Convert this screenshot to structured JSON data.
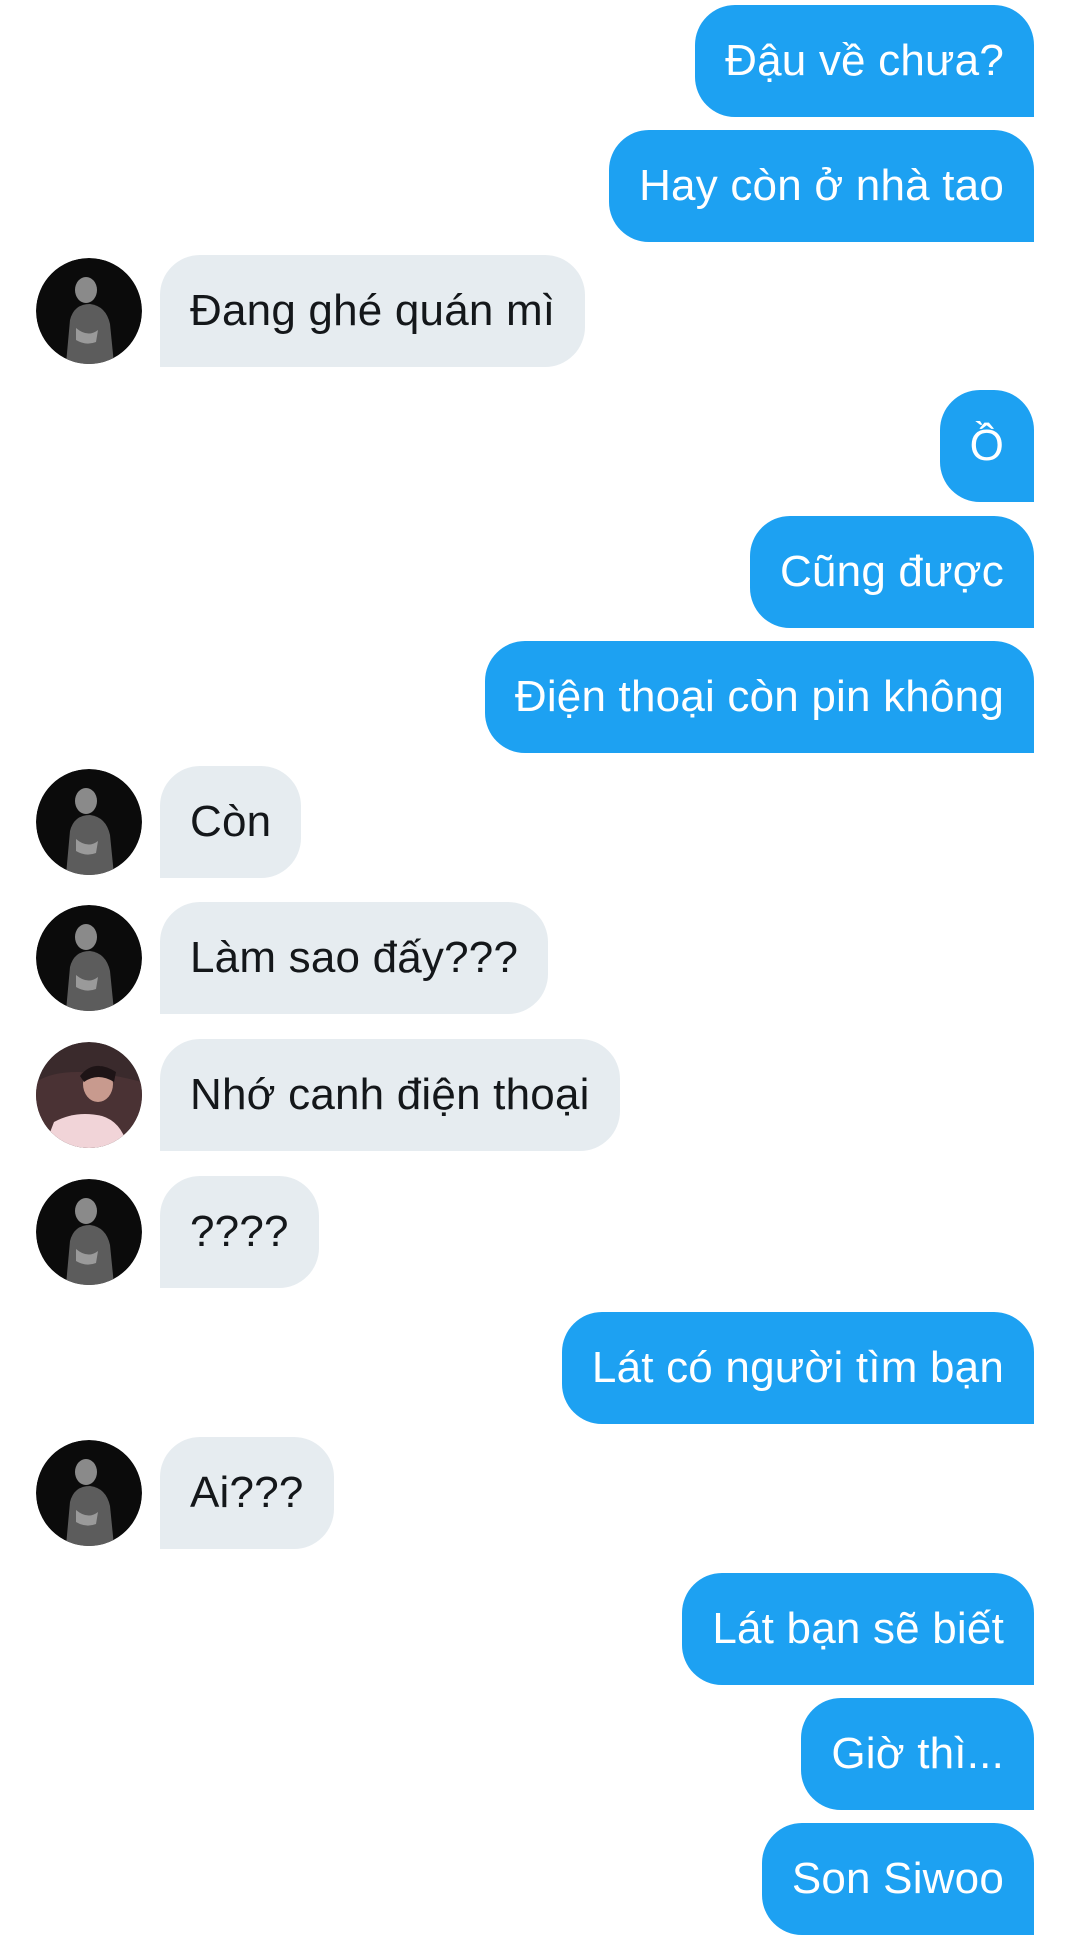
{
  "conversation": {
    "messages": [
      {
        "direction": "out",
        "text": "Đậu về chưa?"
      },
      {
        "direction": "out",
        "text": "Hay còn ở nhà tao"
      },
      {
        "direction": "in",
        "text": "Đang ghé quán mì",
        "avatar": "dark-avatar"
      },
      {
        "direction": "out",
        "text": "Ồ"
      },
      {
        "direction": "out",
        "text": "Cũng được"
      },
      {
        "direction": "out",
        "text": "Điện thoại còn pin không"
      },
      {
        "direction": "in",
        "text": "Còn",
        "avatar": "dark-avatar"
      },
      {
        "direction": "in",
        "text": "Làm sao đấy???",
        "avatar": "dark-avatar"
      },
      {
        "direction": "in",
        "text": "Nhớ canh điện thoại",
        "avatar": "pink-avatar"
      },
      {
        "direction": "in",
        "text": "????",
        "avatar": "dark-avatar"
      },
      {
        "direction": "out",
        "text": "Lát có người tìm bạn"
      },
      {
        "direction": "in",
        "text": "Ai???",
        "avatar": "dark-avatar"
      },
      {
        "direction": "out",
        "text": "Lát bạn sẽ biết"
      },
      {
        "direction": "out",
        "text": "Giờ thì..."
      },
      {
        "direction": "out",
        "text": "Son Siwoo"
      }
    ]
  },
  "colors": {
    "outgoing_bubble": "#1da1f2",
    "incoming_bubble": "#e6ecf0",
    "outgoing_text": "#ffffff",
    "incoming_text": "#14171a",
    "background": "#ffffff"
  }
}
